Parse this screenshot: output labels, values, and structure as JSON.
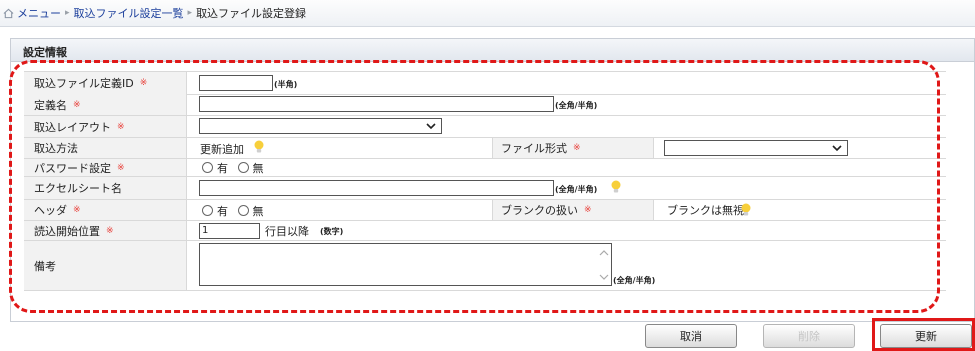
{
  "breadcrumb": {
    "items": [
      "メニュー",
      "取込ファイル設定一覧"
    ],
    "current": "取込ファイル設定登録"
  },
  "section": {
    "title": "設定情報"
  },
  "required_mark": "※",
  "fields": {
    "definition_id": {
      "label": "取込ファイル定義ID",
      "value": "",
      "note": "(半角)"
    },
    "definition_name": {
      "label": "定義名",
      "value": "",
      "note": "(全角/半角)"
    },
    "import_layout": {
      "label": "取込レイアウト",
      "selected": ""
    },
    "import_method": {
      "label": "取込方法",
      "value": "更新追加"
    },
    "file_format": {
      "label": "ファイル形式",
      "selected": ""
    },
    "password": {
      "label": "パスワード設定",
      "options": [
        "有",
        "無"
      ]
    },
    "excel_sheet": {
      "label": "エクセルシート名",
      "value": "",
      "note": "(全角/半角)"
    },
    "header": {
      "label": "ヘッダ",
      "options": [
        "有",
        "無"
      ]
    },
    "blank_handling": {
      "label": "ブランクの扱い",
      "value": "ブランクは無視"
    },
    "start_row": {
      "label": "読込開始位置",
      "value": "1",
      "suffix": "行目以降",
      "note": "(数字)"
    },
    "remarks": {
      "label": "備考",
      "value": "",
      "note": "(全角/半角)"
    }
  },
  "buttons": {
    "cancel": "取消",
    "delete": "削除",
    "update": "更新"
  },
  "colors": {
    "annotation": "#e01818",
    "link": "#1c3f9c",
    "required": "#e8403a"
  }
}
